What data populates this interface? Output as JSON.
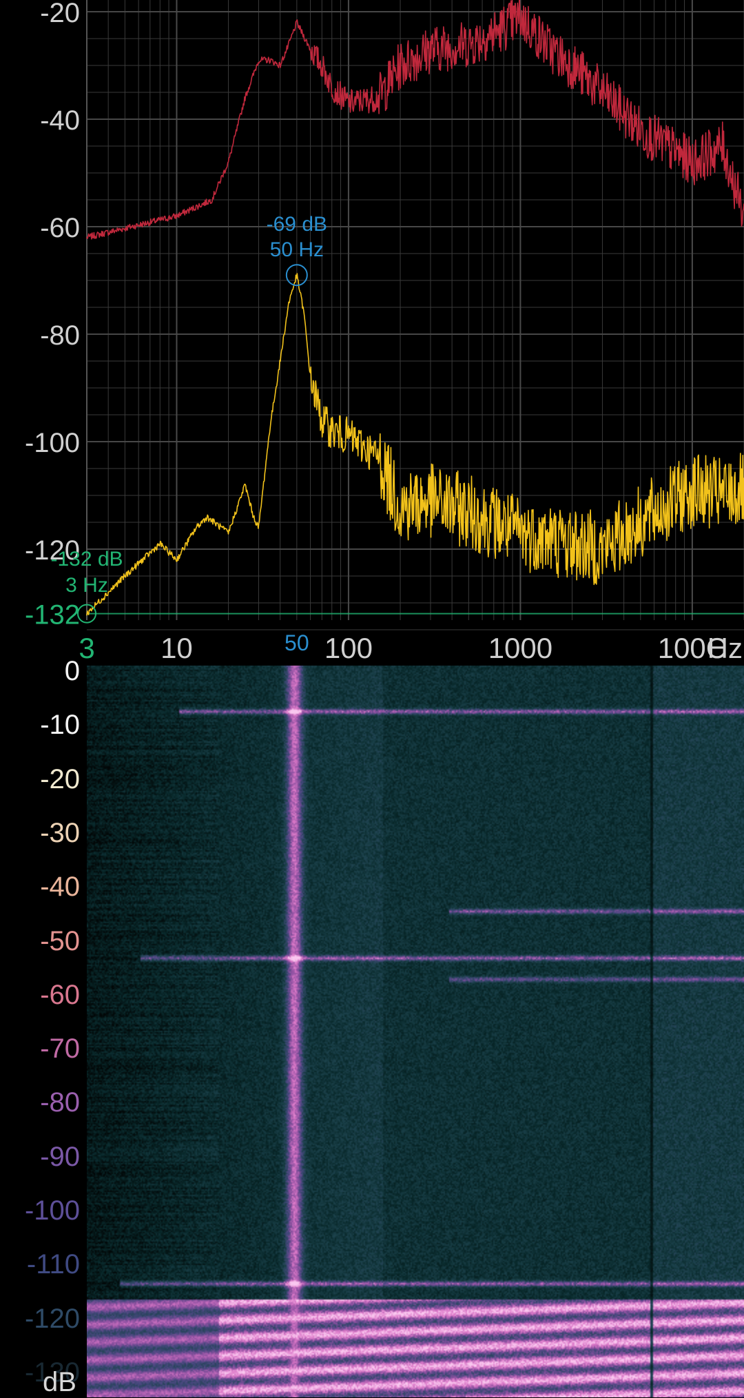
{
  "spectrum": {
    "y_ticks": [
      "-20",
      "-40",
      "-60",
      "-80",
      "-100",
      "-120"
    ],
    "x_ticks": [
      "10",
      "100",
      "1000",
      "100C"
    ],
    "x_unit": "Hz",
    "min_marker": {
      "axis_label": "-132",
      "x_label": "3",
      "db_label": "-132 dB",
      "hz_label": "3 Hz",
      "color": "#22b573"
    },
    "peak_marker": {
      "db_label": "-69 dB",
      "hz_label": "50 Hz",
      "x_label": "50",
      "color": "#2a8fd0"
    },
    "colors": {
      "red_trace": "#c0283c",
      "yellow_trace": "#f2c21b",
      "grid": "#3a3a3a",
      "tick_text": "#d0d0d0"
    }
  },
  "chart_data": {
    "type": "line",
    "xscale": "log",
    "xlim": [
      3,
      20000
    ],
    "ylim": [
      -135,
      -18
    ],
    "series": [
      {
        "color": "#c0283c",
        "x": [
          3,
          10,
          16,
          20,
          25,
          30,
          35,
          40,
          45,
          50,
          60,
          70,
          80,
          100,
          150,
          200,
          300,
          500,
          700,
          1000,
          1500,
          2000,
          3000,
          5000,
          10000,
          15000,
          20000
        ],
        "y": [
          -62,
          -58,
          -55,
          -48,
          -36,
          -29,
          -29,
          -30,
          -26,
          -22,
          -27,
          -30,
          -34,
          -37,
          -36,
          -30,
          -27,
          -26,
          -24,
          -21,
          -27,
          -30,
          -35,
          -42,
          -48,
          -45,
          -58
        ]
      },
      {
        "color": "#f2c21b",
        "x": [
          3,
          5,
          8,
          10,
          13,
          15,
          20,
          25,
          28,
          30,
          35,
          40,
          45,
          50,
          55,
          60,
          70,
          80,
          100,
          150,
          200,
          300,
          500,
          1000,
          2000,
          3000,
          5000,
          10000,
          15000,
          20000
        ],
        "y": [
          -132,
          -125,
          -119,
          -122,
          -116,
          -114,
          -117,
          -108,
          -114,
          -116,
          -97,
          -85,
          -74,
          -69,
          -76,
          -88,
          -96,
          -98,
          -99,
          -103,
          -112,
          -111,
          -113,
          -117,
          -119,
          -120,
          -115,
          -109,
          -110,
          -109
        ]
      }
    ]
  },
  "spectrogram": {
    "time_ticks": [
      "0",
      "-10",
      "-20",
      "-30",
      "-40",
      "-50",
      "-60",
      "-70",
      "-80",
      "-90",
      "-100",
      "-110",
      "-120",
      "-130"
    ],
    "unit": "dB",
    "tick_colors": [
      "#f4f4f4",
      "#f4f4f4",
      "#f1ead0",
      "#ecd2b4",
      "#e9b49a",
      "#e39390",
      "#d9778f",
      "#c06aa4",
      "#9a5fae",
      "#7a58a6",
      "#5d4f98",
      "#3f4a82",
      "#2e4a66",
      "#2d4a5c"
    ]
  }
}
